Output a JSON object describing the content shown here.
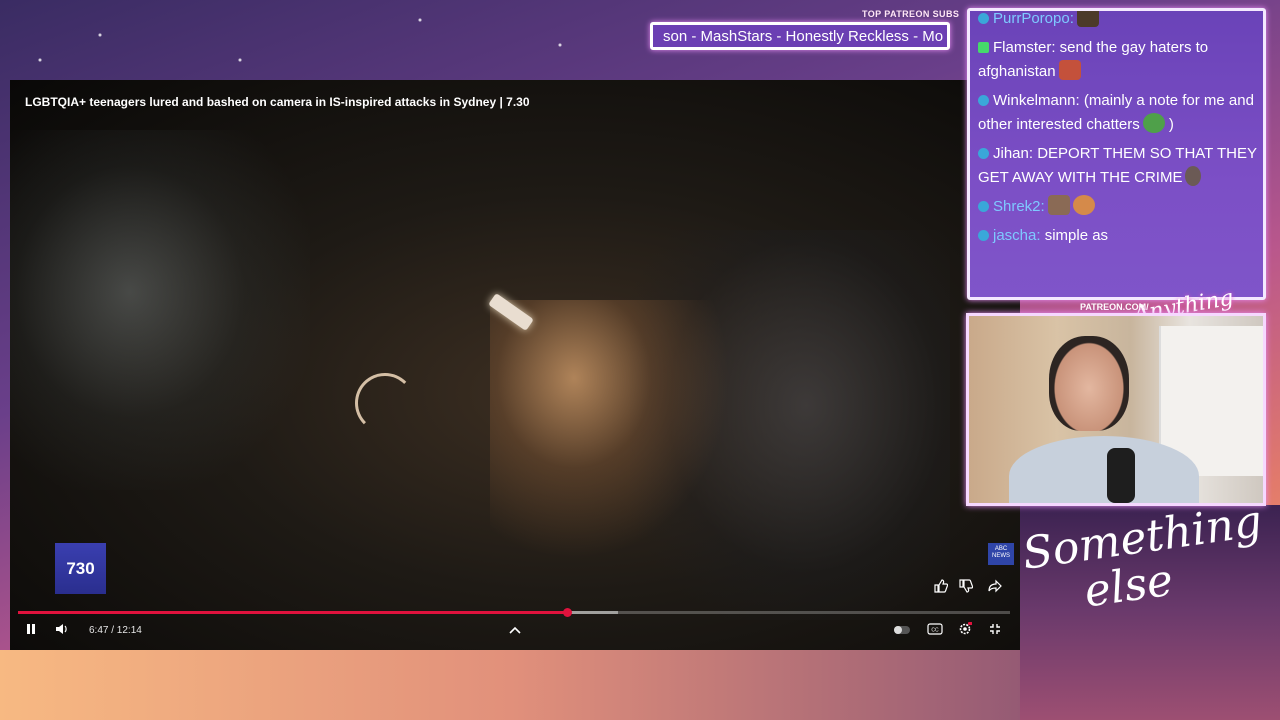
{
  "overlay": {
    "ticker_label": "TOP PATREON SUBS",
    "ticker_text": "son - MashStars - Honestly Reckless - Mo",
    "patreon_url": "PATREON.COM/",
    "signature_small": "Anything else",
    "signature_large": "Something else"
  },
  "video": {
    "title": "LGBTQIA+ teenagers lured and bashed on camera in IS-inspired attacks in Sydney | 7.30",
    "channel_logo": "730",
    "news_logo": "ABC NEWS",
    "progress_fraction": 0.553,
    "buffer_fraction": 0.605,
    "time_display": "6:47 / 12:14",
    "icons": {
      "pause": "pause-icon",
      "volume": "volume-icon",
      "chevron": "chevron-up-icon",
      "like": "thumbs-up-icon",
      "dislike": "thumbs-down-icon",
      "share": "share-icon",
      "autoplay": "autoplay-toggle",
      "captions": "captions-icon",
      "settings": "settings-icon",
      "fullscreen": "exit-fullscreen-icon"
    }
  },
  "chat": {
    "messages": [
      {
        "badge": "blue",
        "user": "PurrPoropo:",
        "user_color": "blue",
        "text": "",
        "emotes": [
          "a"
        ]
      },
      {
        "badge": "green",
        "user": "Flamster:",
        "user_color": "white",
        "text": "send the gay haters to afghanistan",
        "emotes": [
          "b"
        ]
      },
      {
        "badge": "blue",
        "user": "Winkelmann:",
        "user_color": "white",
        "text": "(mainly a note for me and other interested chatters",
        "emotes": [
          "c"
        ],
        "suffix": ")"
      },
      {
        "badge": "blue",
        "user": "Jihan:",
        "user_color": "white",
        "text": "DEPORT THEM SO THAT THEY GET AWAY WITH THE CRIME",
        "emotes": [
          "d"
        ]
      },
      {
        "badge": "blue",
        "user": "Shrek2:",
        "user_color": "blue",
        "text": "",
        "emotes": [
          "e",
          "f"
        ]
      },
      {
        "badge": "blue",
        "user": "jascha:",
        "user_color": "blue",
        "text": "simple as",
        "emotes": []
      }
    ]
  }
}
